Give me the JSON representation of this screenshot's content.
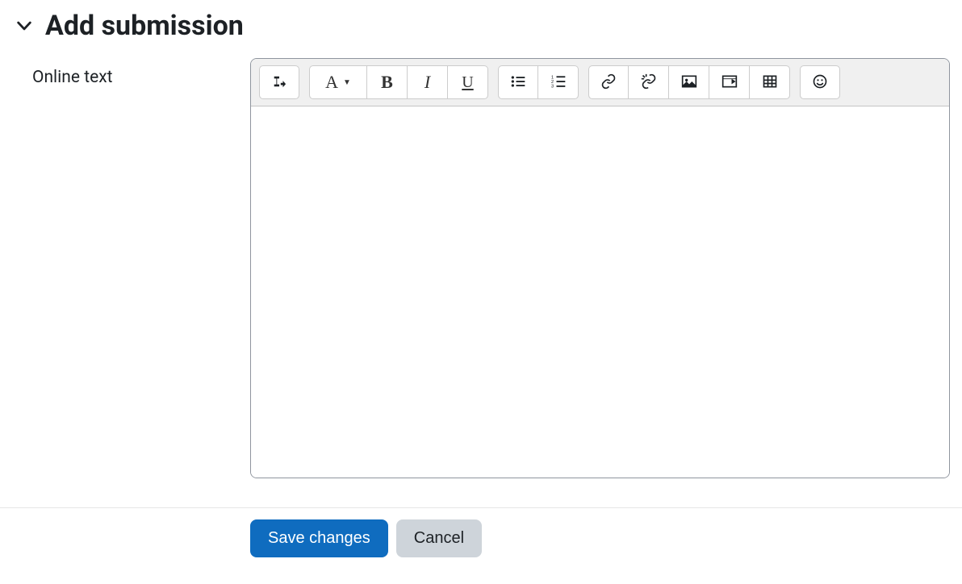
{
  "header": {
    "title": "Add submission"
  },
  "form": {
    "online_text_label": "Online text",
    "editor_value": ""
  },
  "toolbar": {
    "expand": "expand-toolbar-icon",
    "styles": "A",
    "bold": "B",
    "italic": "I",
    "underline": "U"
  },
  "actions": {
    "save_label": "Save changes",
    "cancel_label": "Cancel"
  }
}
